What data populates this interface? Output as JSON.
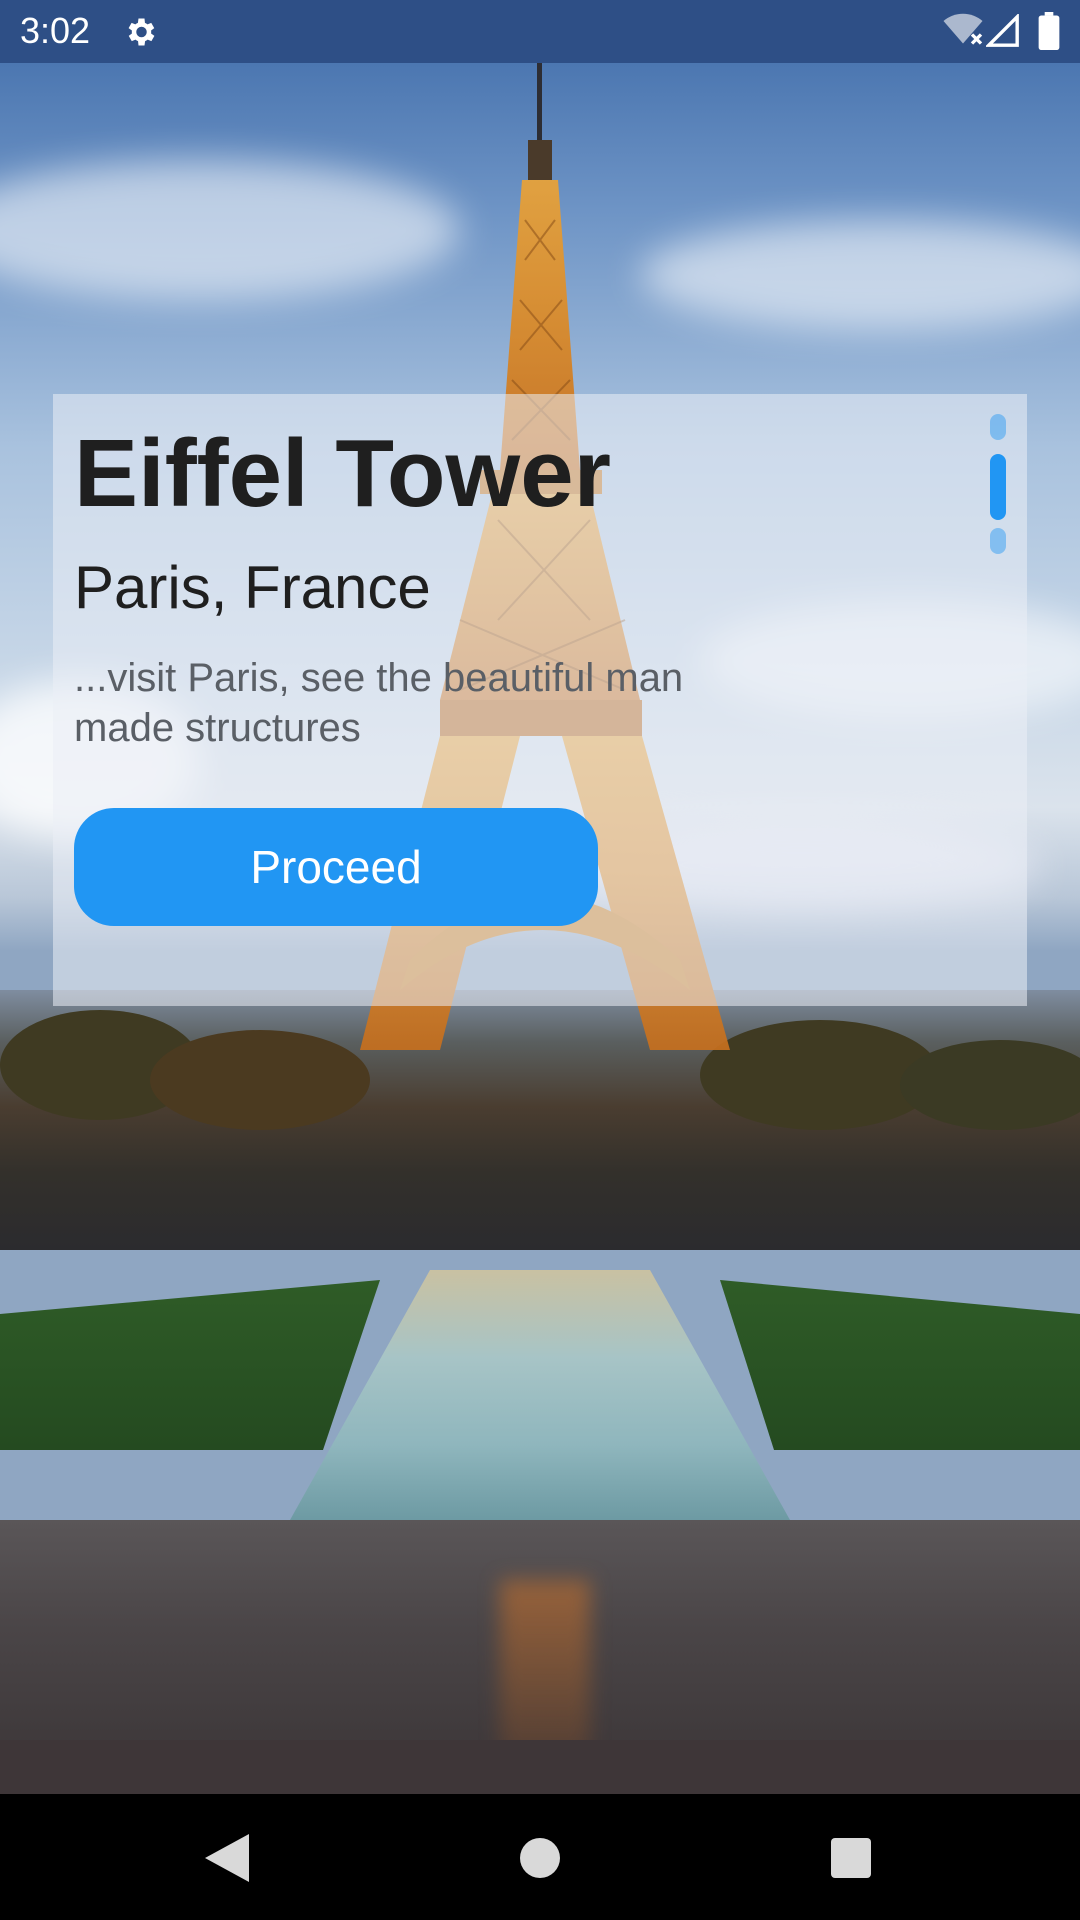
{
  "status_bar": {
    "time": "3:02",
    "icons": [
      "settings-icon",
      "wifi-off-icon",
      "signal-icon",
      "battery-icon"
    ]
  },
  "card": {
    "title": "Eiffel Tower",
    "subtitle": "Paris, France",
    "description": "...visit Paris, see the beautiful man made structures",
    "button_label": "Proceed",
    "page_indicator": {
      "count": 3,
      "active_index": 1
    }
  },
  "nav_bar": {
    "icons": [
      "back-icon",
      "home-icon",
      "recents-icon"
    ]
  },
  "colors": {
    "accent": "#2196f3",
    "status_bar": "#2e4f86",
    "title_text": "#1f1f1f",
    "description_text": "#5a5f66"
  }
}
